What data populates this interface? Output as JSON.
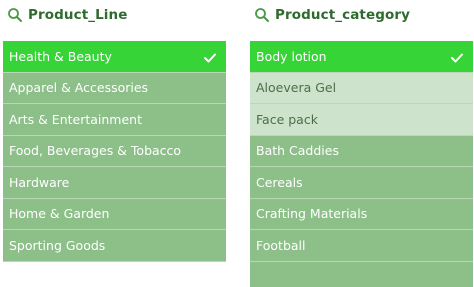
{
  "left_panel": {
    "title": "Product_Line",
    "items": [
      {
        "label": "Health & Beauty",
        "state": "selected"
      },
      {
        "label": "Apparel & Accessories",
        "state": "possible"
      },
      {
        "label": "Arts & Entertainment",
        "state": "possible"
      },
      {
        "label": "Food, Beverages & Tobacco",
        "state": "possible"
      },
      {
        "label": "Hardware",
        "state": "possible"
      },
      {
        "label": "Home & Garden",
        "state": "possible"
      },
      {
        "label": "Sporting Goods",
        "state": "possible"
      }
    ]
  },
  "right_panel": {
    "title": "Product_category",
    "items": [
      {
        "label": "Body lotion",
        "state": "selected"
      },
      {
        "label": "Aloevera Gel",
        "state": "alternative"
      },
      {
        "label": "Face pack",
        "state": "alternative"
      },
      {
        "label": "Bath Caddies",
        "state": "possible"
      },
      {
        "label": "Cereals",
        "state": "possible"
      },
      {
        "label": "Crafting Materials",
        "state": "possible"
      },
      {
        "label": "Football",
        "state": "possible"
      },
      {
        "label": "",
        "state": "possible"
      }
    ]
  },
  "colors": {
    "selected": "#36d436",
    "alternative": "#cde3cc",
    "possible": "#8dbf89",
    "title": "#2f6b2f"
  },
  "icons": {
    "search": "search-icon",
    "check": "check-icon"
  }
}
